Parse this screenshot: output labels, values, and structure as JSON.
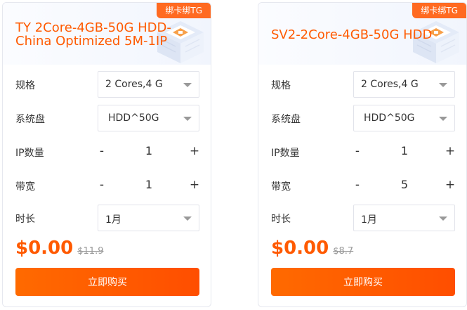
{
  "cards": [
    {
      "badge": "绑卡绑TG",
      "title": "TY 2Core-4GB-50G HDD-China Optimized 5M-1IP",
      "spec": {
        "label": "规格",
        "value": "2 Cores,4 G"
      },
      "disk": {
        "label": "系统盘",
        "value": "HDD^50G"
      },
      "ip": {
        "label": "IP数量",
        "minus": "-",
        "value": "1",
        "plus": "+"
      },
      "bandwidth": {
        "label": "带宽",
        "minus": "-",
        "value": "1",
        "plus": "+"
      },
      "duration": {
        "label": "时长",
        "value": "1月"
      },
      "price": "$0.00",
      "original_price": "$11.9",
      "buy_label": "立即购买"
    },
    {
      "badge": "绑卡绑TG",
      "title": "SV2-2Core-4GB-50G HDD",
      "spec": {
        "label": "规格",
        "value": "2 Cores,4 G"
      },
      "disk": {
        "label": "系统盘",
        "value": "HDD^50G"
      },
      "ip": {
        "label": "IP数量",
        "minus": "-",
        "value": "1",
        "plus": "+"
      },
      "bandwidth": {
        "label": "带宽",
        "minus": "-",
        "value": "5",
        "plus": "+"
      },
      "duration": {
        "label": "时长",
        "value": "1月"
      },
      "price": "$0.00",
      "original_price": "$8.7",
      "buy_label": "立即购买"
    }
  ],
  "colors": {
    "accent": "#ff5a00",
    "badge_bg": "#ff6a21",
    "border": "#e6e8ef",
    "muted": "#999999"
  },
  "icons": [
    "server-rack-icon",
    "chevron-down-icon"
  ]
}
